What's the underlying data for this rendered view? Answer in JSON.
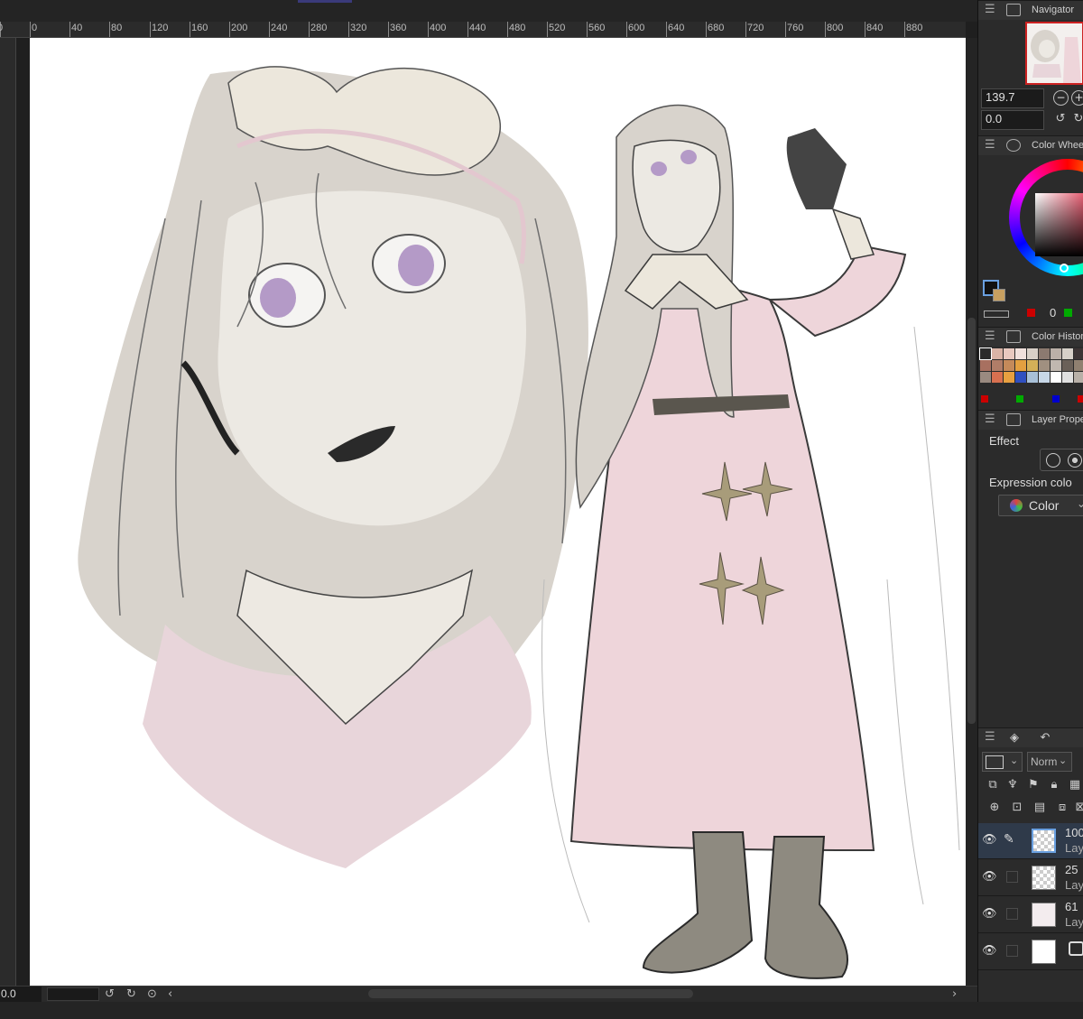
{
  "ruler": {
    "ticks": [
      "0",
      "0",
      "40",
      "80",
      "120",
      "160",
      "200",
      "240",
      "280",
      "320",
      "360",
      "400",
      "440",
      "480",
      "520",
      "560",
      "600",
      "640",
      "680",
      "720",
      "760",
      "800",
      "840",
      "880"
    ]
  },
  "status": {
    "zoom": "0.0"
  },
  "navigator": {
    "title": "Navigator",
    "zoom_value": "139.7",
    "rotation_value": "0.0"
  },
  "color_wheel": {
    "title": "Color Whee",
    "value_label": "0",
    "main_color": "#111111",
    "sub_color": "#c8a060"
  },
  "color_history": {
    "title": "Color Histor",
    "swatches": [
      "#2b2b2b",
      "#d9b3a6",
      "#e8c9c0",
      "#f0e0dc",
      "#d8cfc7",
      "#8c7a70",
      "#bbb0a8",
      "#d6d0c8",
      "#3c3535",
      "#a87060",
      "#b07d68",
      "#c48a5a",
      "#e3a040",
      "#d4b058",
      "#a09080",
      "#c0b8b0",
      "#6a6058",
      "#908070",
      "#9a8a80",
      "#d87050",
      "#e8a040",
      "#3050c0",
      "#a8c0d8",
      "#c8d8e8",
      "#ffffff",
      "#e0e0e0",
      "#b8b0a8"
    ],
    "mini_colors": [
      "#cc0000",
      "#00aa00",
      "#0000cc",
      "#cc0000"
    ]
  },
  "layer_property": {
    "title": "Layer Prope",
    "effect_label": "Effect",
    "expression_label": "Expression colo",
    "color_option": "Color"
  },
  "layers": {
    "blend_mode": "Norm",
    "items": [
      {
        "opacity": "100",
        "name": "Lay",
        "active": true
      },
      {
        "opacity": "25",
        "name": "Lay",
        "active": false
      },
      {
        "opacity": "61",
        "name": "Lay",
        "active": false
      },
      {
        "opacity": "",
        "name": "",
        "active": false
      }
    ]
  }
}
